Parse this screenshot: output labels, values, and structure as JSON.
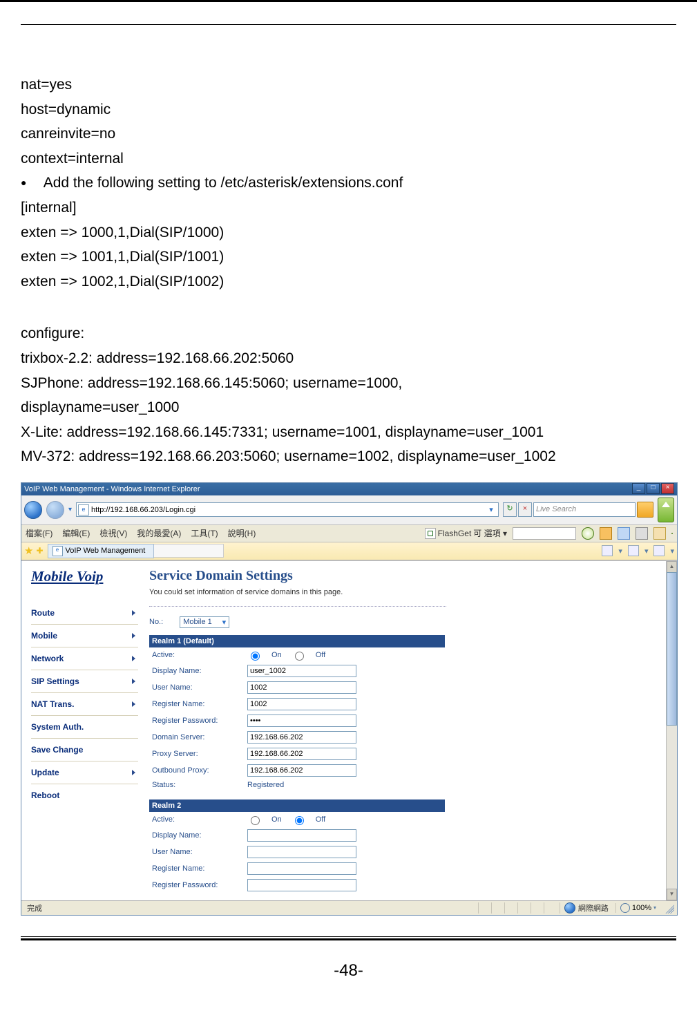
{
  "config_lines": {
    "l1": "nat=yes",
    "l2": "host=dynamic",
    "l3": "canreinvite=no",
    "l4": "context=internal"
  },
  "bullet1": "Add the following setting to /etc/asterisk/extensions.conf",
  "internal_block": {
    "l1": "[internal]",
    "l2": "exten => 1000,1,Dial(SIP/1000)",
    "l3": "exten => 1001,1,Dial(SIP/1001)",
    "l4": "exten => 1002,1,Dial(SIP/1002)"
  },
  "configure_header": "configure:",
  "configure": {
    "l1": "trixbox-2.2: address=192.168.66.202:5060",
    "l2": "SJPhone: address=192.168.66.145:5060; username=1000,",
    "l3": "displayname=user_1000",
    "l4": "X-Lite: address=192.168.66.145:7331; username=1001, displayname=user_1001",
    "l5": "MV-372: address=192.168.66.203:5060; username=1002, displayname=user_1002"
  },
  "ie": {
    "title": "VoIP Web Management - Windows Internet Explorer",
    "url": "http://192.168.66.203/Login.cgi",
    "search_placeholder": "Live Search",
    "menu": {
      "m1": "檔案(F)",
      "m2": "編輯(E)",
      "m3": "檢視(V)",
      "m4": "我的最愛(A)",
      "m5": "工具(T)",
      "m6": "說明(H)"
    },
    "flashget": "FlashGet",
    "flashget_opt": "可 選項 ▾",
    "tab_title": "VoIP Web Management",
    "status_done": "完成",
    "status_net": "網際網路",
    "zoom": "100%"
  },
  "voip": {
    "logo": "Mobile Voip",
    "nav": {
      "route": "Route",
      "mobile": "Mobile",
      "network": "Network",
      "sip": "SIP Settings",
      "nat": "NAT Trans.",
      "sysauth": "System Auth.",
      "save": "Save Change",
      "update": "Update",
      "reboot": "Reboot"
    },
    "panel": {
      "title": "Service Domain Settings",
      "desc": "You could set information of service domains in this page.",
      "no_label": "No.:",
      "no_value": "Mobile 1",
      "realm1_header": "Realm 1 (Default)",
      "realm2_header": "Realm 2",
      "labels": {
        "active": "Active:",
        "display_name": "Display Name:",
        "user_name": "User Name:",
        "register_name": "Register Name:",
        "register_password": "Register Password:",
        "domain_server": "Domain Server:",
        "proxy_server": "Proxy Server:",
        "outbound_proxy": "Outbound Proxy:",
        "status": "Status:"
      },
      "on": "On",
      "off": "Off",
      "realm1": {
        "active": "on",
        "display_name": "user_1002",
        "user_name": "1002",
        "register_name": "1002",
        "register_password": "••••",
        "domain_server": "192.168.66.202",
        "proxy_server": "192.168.66.202",
        "outbound_proxy": "192.168.66.202",
        "status": "Registered"
      },
      "realm2": {
        "active": "off",
        "display_name": "",
        "user_name": "",
        "register_name": "",
        "register_password": ""
      }
    }
  },
  "page_number": "-48-"
}
